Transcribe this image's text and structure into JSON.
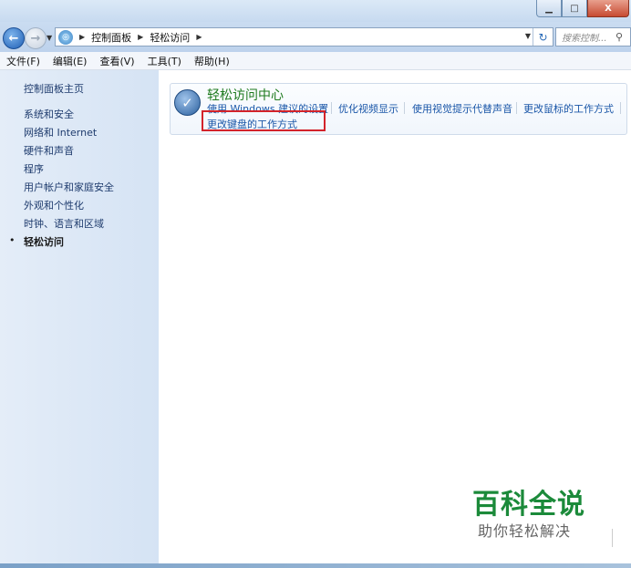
{
  "window": {
    "minimize_label": "▁",
    "maximize_label": "□",
    "close_label": "X"
  },
  "address": {
    "breadcrumbs": [
      "控制面板",
      "轻松访问"
    ],
    "search_placeholder": "搜索控制..."
  },
  "menu": {
    "items": [
      "文件(F)",
      "编辑(E)",
      "查看(V)",
      "工具(T)",
      "帮助(H)"
    ]
  },
  "sidebar": {
    "home": "控制面板主页",
    "items": [
      "系统和安全",
      "网络和 Internet",
      "硬件和声音",
      "程序",
      "用户帐户和家庭安全",
      "外观和个性化",
      "时钟、语言和区域",
      "轻松访问"
    ],
    "active_index": 7
  },
  "main": {
    "category_title": "轻松访问中心",
    "tasks": [
      "使用 Windows 建议的设置",
      "优化视频显示",
      "使用视觉提示代替声音",
      "更改鼠标的工作方式",
      "更改键盘的工作方式"
    ]
  },
  "watermark": {
    "title": "百科全说",
    "subtitle": "助你轻松解决"
  },
  "colors": {
    "link": "#1a56a8",
    "title_green": "#1e7a1e",
    "highlight_red": "#d3232a",
    "sidebar_bg": "#dce8f6"
  }
}
